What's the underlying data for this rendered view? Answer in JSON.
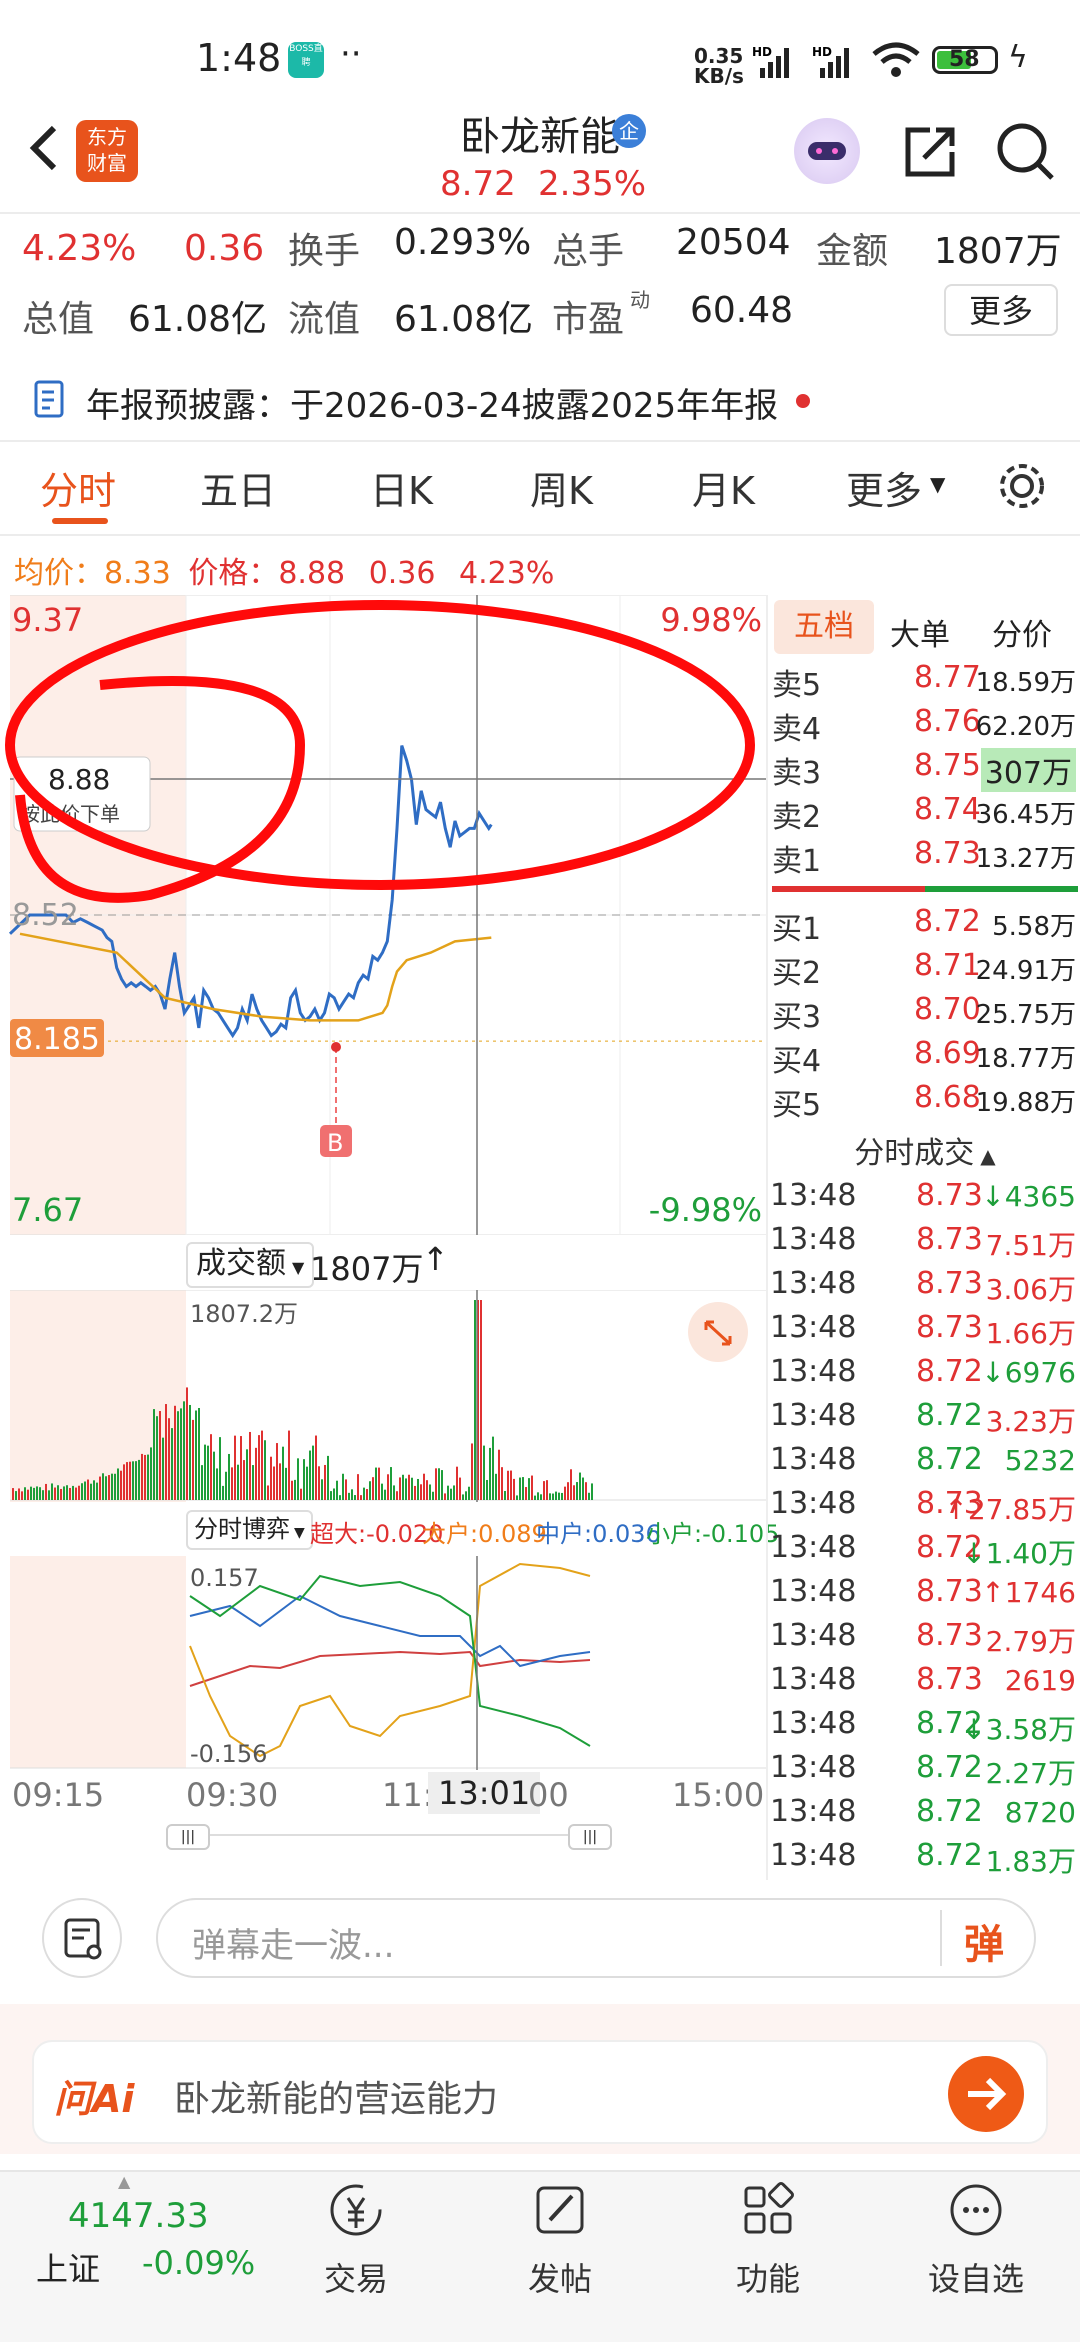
{
  "status_bar": {
    "time": "1:48",
    "speed": "0.35\nKB/s",
    "speed_top": "0.35",
    "speed_bottom": "KB/s",
    "battery": "58",
    "boss_badge": "BOSS直聘"
  },
  "header": {
    "logo_line1": "东方",
    "logo_line2": "财富",
    "stock_name": "卧龙新能",
    "badge": "企",
    "price": "8.72",
    "change_pct": "2.35%"
  },
  "stats": {
    "amp": "4.23%",
    "chg": "0.36",
    "turnover_label": "换手",
    "turnover": "0.293%",
    "vol_label": "总手",
    "vol": "20504",
    "amount_label": "金额",
    "amount": "1807万",
    "mktcap_label": "总值",
    "mktcap": "61.08亿",
    "float_label": "流值",
    "float": "61.08亿",
    "pe_label": "市盈",
    "pe_sup": "动",
    "pe": "60.48",
    "more_btn": "更多"
  },
  "notice": {
    "text": "年报预披露：于2026-03-24披露2025年年报"
  },
  "tabs": [
    "分时",
    "五日",
    "日K",
    "周K",
    "月K",
    "更多"
  ],
  "summary": {
    "avg_label": "均价：",
    "avg": "8.33",
    "price_label": "价格：",
    "price": "8.88",
    "chg": "0.36",
    "pct": "4.23%"
  },
  "chart_data": {
    "type": "line",
    "title": "",
    "ylim": [
      7.67,
      9.37
    ],
    "y_top_label": "9.37",
    "y_bottom_label": "7.67",
    "pct_top_label": "9.98%",
    "pct_bottom_label": "-9.98%",
    "prev_close_label": "8.52",
    "low_label": "8.185",
    "crosshair_price": "8.88",
    "crosshair_hint": "按此价下单",
    "marker_label": "B",
    "x_tick_labels": [
      "09:15",
      "09:30",
      "11:3",
      "13:01",
      "00",
      "15:00"
    ],
    "series": [
      {
        "name": "价格",
        "x": [
          0,
          8,
          14,
          20,
          26,
          32,
          38,
          44,
          50,
          56,
          62,
          68,
          72,
          76,
          80,
          84,
          88,
          92,
          96,
          100,
          104,
          108,
          112,
          116,
          120,
          124,
          128,
          132,
          136,
          140,
          144,
          148,
          152,
          156,
          160,
          164,
          168,
          172,
          176,
          180,
          184,
          188,
          192,
          196,
          200,
          204,
          208,
          212,
          216,
          220,
          224,
          228,
          232,
          236,
          240,
          244,
          248,
          252,
          256,
          260,
          264,
          268,
          272,
          276,
          280,
          284,
          288,
          292,
          296,
          300,
          304,
          308,
          312,
          316,
          320,
          324,
          328,
          332,
          336,
          340,
          344,
          348,
          352,
          356,
          360,
          364,
          368,
          372,
          376,
          380,
          384,
          388,
          390
        ],
        "values": [
          8.47,
          8.52,
          8.52,
          8.52,
          8.52,
          8.52,
          8.52,
          8.5,
          8.51,
          8.5,
          8.49,
          8.48,
          8.46,
          8.45,
          8.38,
          8.35,
          8.33,
          8.34,
          8.33,
          8.34,
          8.33,
          8.32,
          8.33,
          8.31,
          8.27,
          8.35,
          8.42,
          8.33,
          8.26,
          8.28,
          8.3,
          8.22,
          8.32,
          8.3,
          8.27,
          8.26,
          8.24,
          8.22,
          8.2,
          8.22,
          8.27,
          8.24,
          8.31,
          8.27,
          8.24,
          8.22,
          8.2,
          8.21,
          8.23,
          8.22,
          8.3,
          8.32,
          8.26,
          8.24,
          8.25,
          8.27,
          8.24,
          8.26,
          8.31,
          8.3,
          8.27,
          8.29,
          8.31,
          8.3,
          8.34,
          8.36,
          8.35,
          8.41,
          8.4,
          8.42,
          8.45,
          8.56,
          8.75,
          8.97,
          8.93,
          8.88,
          8.76,
          8.85,
          8.8,
          8.79,
          8.78,
          8.82,
          8.75,
          8.7,
          8.77,
          8.73,
          8.74,
          8.75,
          8.75,
          8.79,
          8.77,
          8.75,
          8.76
        ]
      },
      {
        "name": "均价",
        "x": [
          0,
          80,
          120,
          160,
          200,
          240,
          280,
          300,
          304,
          308,
          312,
          320,
          340,
          360,
          390
        ],
        "values": [
          8.47,
          8.42,
          8.3,
          8.27,
          8.25,
          8.24,
          8.24,
          8.26,
          8.28,
          8.33,
          8.37,
          8.4,
          8.42,
          8.45,
          8.46
        ]
      }
    ]
  },
  "volume": {
    "label": "成交额",
    "total": "1807万",
    "max_label": "1807.2万"
  },
  "flow": {
    "label": "分时博弈",
    "super": "超大:-0.020",
    "big": "大户:0.089",
    "mid": "中户:0.036",
    "small": "小户:-0.105",
    "max_label": "0.157",
    "min_label": "-0.156"
  },
  "orderbook": {
    "tabs": [
      "五档",
      "大单",
      "分价"
    ],
    "asks": [
      {
        "label": "卖5",
        "price": "8.77",
        "vol": "18.59万"
      },
      {
        "label": "卖4",
        "price": "8.76",
        "vol": "62.20万"
      },
      {
        "label": "卖3",
        "price": "8.75",
        "vol": "307万"
      },
      {
        "label": "卖2",
        "price": "8.74",
        "vol": "36.45万"
      },
      {
        "label": "卖1",
        "price": "8.73",
        "vol": "13.27万"
      }
    ],
    "bids": [
      {
        "label": "买1",
        "price": "8.72",
        "vol": "5.58万"
      },
      {
        "label": "买2",
        "price": "8.71",
        "vol": "24.91万"
      },
      {
        "label": "买3",
        "price": "8.70",
        "vol": "25.75万"
      },
      {
        "label": "买4",
        "price": "8.69",
        "vol": "18.77万"
      },
      {
        "label": "买5",
        "price": "8.68",
        "vol": "19.88万"
      }
    ],
    "trades_header": "分时成交",
    "trades": [
      {
        "time": "13:48",
        "price": "8.73",
        "vol": "↓4365",
        "pc": "red",
        "vc": "green"
      },
      {
        "time": "13:48",
        "price": "8.73",
        "vol": "7.51万",
        "pc": "red",
        "vc": "red"
      },
      {
        "time": "13:48",
        "price": "8.73",
        "vol": "3.06万",
        "pc": "red",
        "vc": "red"
      },
      {
        "time": "13:48",
        "price": "8.73",
        "vol": "1.66万",
        "pc": "red",
        "vc": "red"
      },
      {
        "time": "13:48",
        "price": "8.72",
        "vol": "↓6976",
        "pc": "red",
        "vc": "green"
      },
      {
        "time": "13:48",
        "price": "8.72",
        "vol": "3.23万",
        "pc": "green",
        "vc": "red"
      },
      {
        "time": "13:48",
        "price": "8.72",
        "vol": "5232",
        "pc": "green",
        "vc": "green"
      },
      {
        "time": "13:48",
        "price": "8.73",
        "vol": "↑27.85万",
        "pc": "red",
        "vc": "red"
      },
      {
        "time": "13:48",
        "price": "8.72",
        "vol": "↓1.40万",
        "pc": "red",
        "vc": "green"
      },
      {
        "time": "13:48",
        "price": "8.73",
        "vol": "↑1746",
        "pc": "red",
        "vc": "red"
      },
      {
        "time": "13:48",
        "price": "8.73",
        "vol": "2.79万",
        "pc": "red",
        "vc": "red"
      },
      {
        "time": "13:48",
        "price": "8.73",
        "vol": "2619",
        "pc": "red",
        "vc": "red"
      },
      {
        "time": "13:48",
        "price": "8.72",
        "vol": "↓3.58万",
        "pc": "green",
        "vc": "green"
      },
      {
        "time": "13:48",
        "price": "8.72",
        "vol": "2.27万",
        "pc": "green",
        "vc": "green"
      },
      {
        "time": "13:48",
        "price": "8.72",
        "vol": "8720",
        "pc": "green",
        "vc": "green"
      },
      {
        "time": "13:48",
        "price": "8.72",
        "vol": "1.83万",
        "pc": "green",
        "vc": "green"
      }
    ]
  },
  "comment": {
    "placeholder": "弹幕走一波...",
    "send": "弹"
  },
  "ai": {
    "brand": "问Ai",
    "text": "卧龙新能的营运能力"
  },
  "bottom_nav": {
    "index_value": "4147.33",
    "index_name": "上证",
    "index_chg": "-0.09%",
    "items": [
      "交易",
      "发帖",
      "功能",
      "设自选"
    ]
  },
  "colors": {
    "up": "#e03131",
    "down": "#1e9e3a",
    "avg": "#e3a21a",
    "price_line": "#2f6dc4",
    "accent": "#e8531c"
  }
}
